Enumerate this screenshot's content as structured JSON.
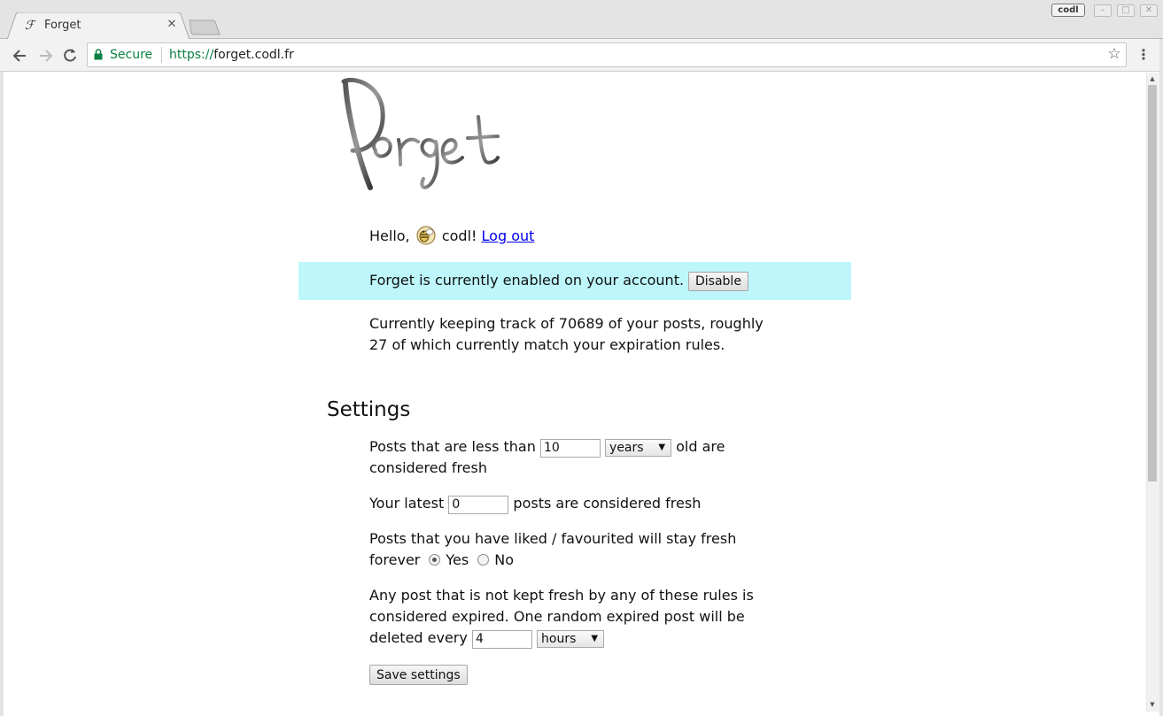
{
  "browser": {
    "tab_title": "Forget",
    "tab_favicon": "forget-favicon",
    "profile_label": "codl",
    "secure_label": "Secure",
    "url_scheme": "https://",
    "url_host": "forget.codl.fr",
    "icons": [
      "back-arrow-icon",
      "forward-arrow-icon",
      "reload-icon",
      "lock-icon",
      "star-icon",
      "menu-icon"
    ]
  },
  "page": {
    "logo_text": "Forget",
    "greeting": {
      "prefix": "Hello,",
      "username": "codl!",
      "logout_label": "Log out"
    },
    "banner": {
      "text": "Forget is currently enabled on your account.",
      "button_label": "Disable",
      "background": "#bdf6fb"
    },
    "tracking_text": "Currently keeping track of 70689 of your posts, roughly 27 of which currently match your expiration rules.",
    "settings": {
      "heading": "Settings",
      "age_rule": {
        "before": "Posts that are less than",
        "value": "10",
        "unit": "years",
        "after": "old are considered fresh"
      },
      "latest_rule": {
        "before": "Your latest",
        "value": "0",
        "after": "posts are considered fresh"
      },
      "liked_rule": {
        "text": "Posts that you have liked / favourited will stay fresh forever",
        "yes_label": "Yes",
        "no_label": "No",
        "selected": "Yes"
      },
      "expire_rule": {
        "text": "Any post that is not kept fresh by any of these rules is considered expired. One random expired post will be deleted every",
        "value": "4",
        "unit": "hours"
      },
      "save_label": "Save settings"
    }
  }
}
